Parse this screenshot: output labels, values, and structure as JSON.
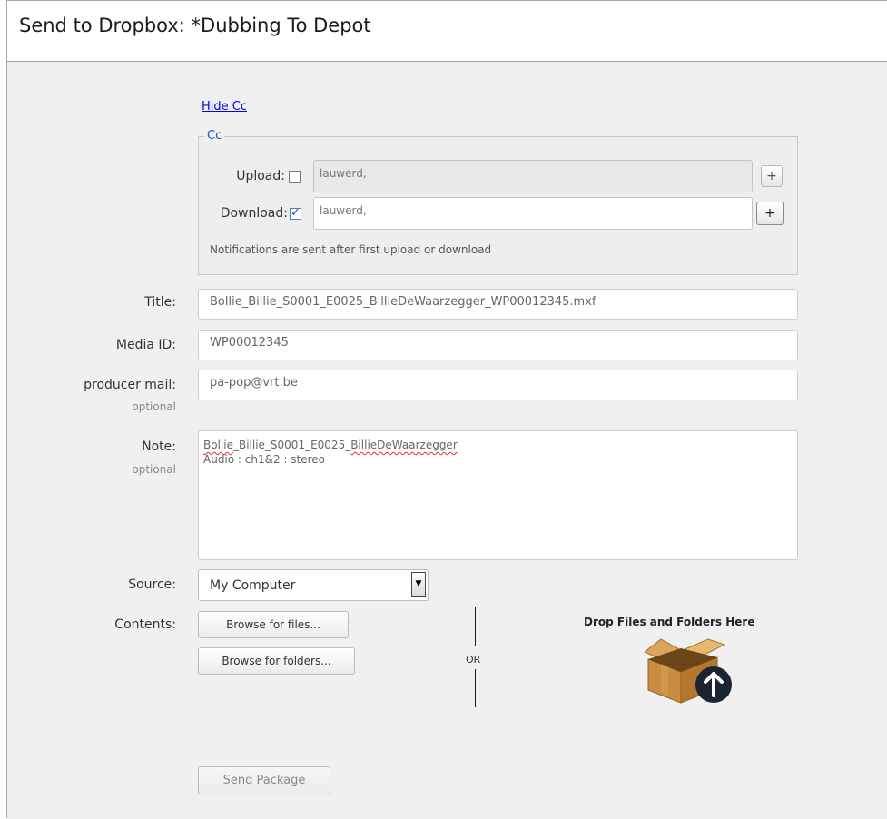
{
  "window": {
    "title": "Send to Dropbox: *Dubbing To Depot"
  },
  "cc": {
    "toggle_link": "Hide Cc",
    "legend": "Cc",
    "upload": {
      "label": "Upload:",
      "checked": false,
      "value": "lauwerd,",
      "add_label": "+"
    },
    "download": {
      "label": "Download:",
      "checked": true,
      "value": "lauwerd,",
      "add_label": "+"
    },
    "notice": "Notifications are sent after first upload or download"
  },
  "form": {
    "title": {
      "label": "Title:",
      "value": "Bollie_Billie_S0001_E0025_BillieDeWaarzegger_WP00012345.mxf"
    },
    "media_id": {
      "label": "Media ID:",
      "value": "WP00012345"
    },
    "producer_mail": {
      "label": "producer mail:",
      "sublabel": "optional",
      "value": "pa-pop@vrt.be"
    },
    "note": {
      "label": "Note:",
      "sublabel": "optional",
      "line1_a": "Bollie",
      "line1_b": "_Billie_S0001_E0025_",
      "line1_c": "BillieDeWaarzegger",
      "line2": "Audio : ch1&2 : stereo"
    },
    "source": {
      "label": "Source:",
      "selected": "My Computer"
    },
    "contents": {
      "label": "Contents:",
      "browse_files": "Browse for files...",
      "browse_folders": "Browse for folders...",
      "or_text": "OR",
      "drop_title": "Drop Files and Folders Here"
    }
  },
  "footer": {
    "send_label": "Send Package"
  },
  "colors": {
    "link": "#0000ee",
    "legend": "#2255cc",
    "upload_badge": "#1a2433"
  }
}
